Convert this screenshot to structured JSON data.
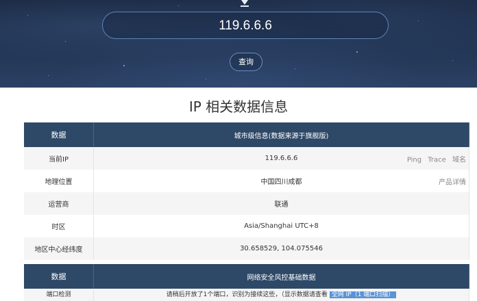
{
  "search": {
    "ip_value": "119.6.6.6",
    "query_label": "查询"
  },
  "section": {
    "title": "IP 相关数据信息"
  },
  "table1": {
    "header_col1": "数据",
    "header_col2": "城市级信息(数据来源于旗舰版)",
    "rows": [
      {
        "label": "当前IP",
        "value": "119.6.6.6"
      },
      {
        "label": "地理位置",
        "value": "中国四川成都"
      },
      {
        "label": "运营商",
        "value": "联通"
      },
      {
        "label": "时区",
        "value": "Asia/Shanghai UTC+8"
      },
      {
        "label": "地区中心经纬度",
        "value": "30.658529, 104.075546"
      }
    ],
    "links": {
      "ping": "Ping",
      "trace": "Trace",
      "domain": "域名",
      "product": "产品详情"
    }
  },
  "table2": {
    "header_col1": "数据",
    "header_col2": "网络安全风控基础数据",
    "partial_label": "端口检测",
    "partial_text": "请稍后开放了1个端口，识别为接续这些，（显示数据请查看",
    "partial_highlight": "全网 IP（1 端口扫描）"
  }
}
